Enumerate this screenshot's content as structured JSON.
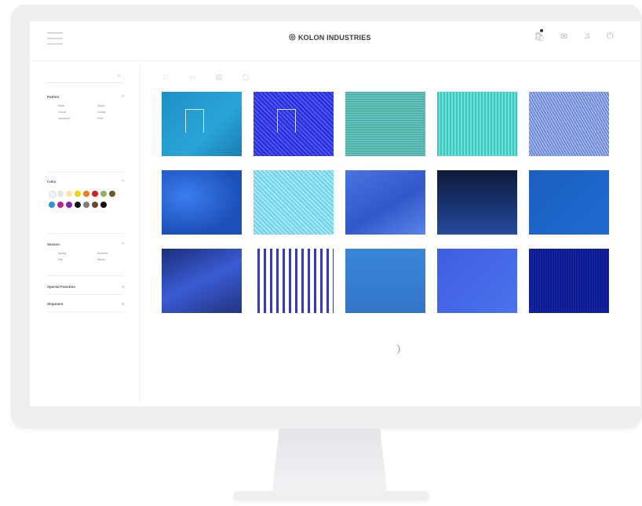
{
  "header": {
    "brand": "KOLON INDUSTRIES",
    "brand_mark": "◎",
    "icons": [
      "menu-icon",
      "cart-icon",
      "mail-icon",
      "bell-icon",
      "power-icon"
    ]
  },
  "sidebar": {
    "sections": [
      {
        "title": "Pattern",
        "options": [
          "Solid",
          "Stripe",
          "Check",
          "Dobby",
          "Jacquard",
          "Print"
        ]
      },
      {
        "title": "Color"
      },
      {
        "title": "Season",
        "options": [
          "Spring",
          "Summer",
          "Fall",
          "Winter"
        ]
      },
      {
        "title": "Special Function"
      },
      {
        "title": "Shipment"
      }
    ],
    "colors": [
      "#f0f0f0",
      "#e8e3d8",
      "#f5e6a8",
      "#f2d20a",
      "#f07a1a",
      "#d92020",
      "#8fb060",
      "#6a5a2a",
      "#2f8fd0",
      "#c0208a",
      "#8a20b0",
      "#151515",
      "#7a7a7a",
      "#6a4a2a",
      "#111111"
    ]
  },
  "toolbar": {
    "icons": [
      "grid-view-icon",
      "list-view-icon",
      "sort-icon",
      "filter-icon"
    ]
  },
  "tiles": [
    "t1",
    "t2",
    "t3",
    "t4",
    "t5",
    "t6",
    "t7",
    "t8",
    "t9",
    "t10",
    "t11",
    "t12",
    "t13",
    "t14",
    "t15"
  ]
}
